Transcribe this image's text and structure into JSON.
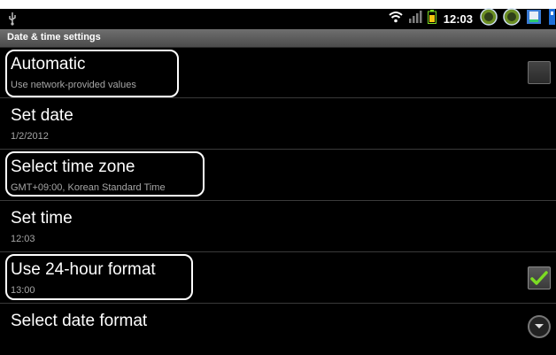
{
  "status_bar": {
    "time": "12:03",
    "icons": [
      "usb-icon",
      "wifi-icon",
      "signal-icon",
      "battery-icon",
      "app-icon-1",
      "app-icon-2",
      "app-icon-3",
      "notification-icon"
    ]
  },
  "title": "Date & time settings",
  "settings": [
    {
      "title": "Automatic",
      "subtitle": "Use network-provided values",
      "control": "checkbox",
      "checked": false
    },
    {
      "title": "Set date",
      "subtitle": "1/2/2012"
    },
    {
      "title": "Select time zone",
      "subtitle": "GMT+09:00, Korean Standard Time"
    },
    {
      "title": "Set time",
      "subtitle": "12:03"
    },
    {
      "title": "Use 24-hour format",
      "subtitle": "13:00",
      "control": "checkbox",
      "checked": true
    },
    {
      "title": "Select date format",
      "control": "dropdown"
    }
  ],
  "colors": {
    "check": "#7cdc23",
    "highlight": "#ffffff",
    "background": "#000000"
  }
}
